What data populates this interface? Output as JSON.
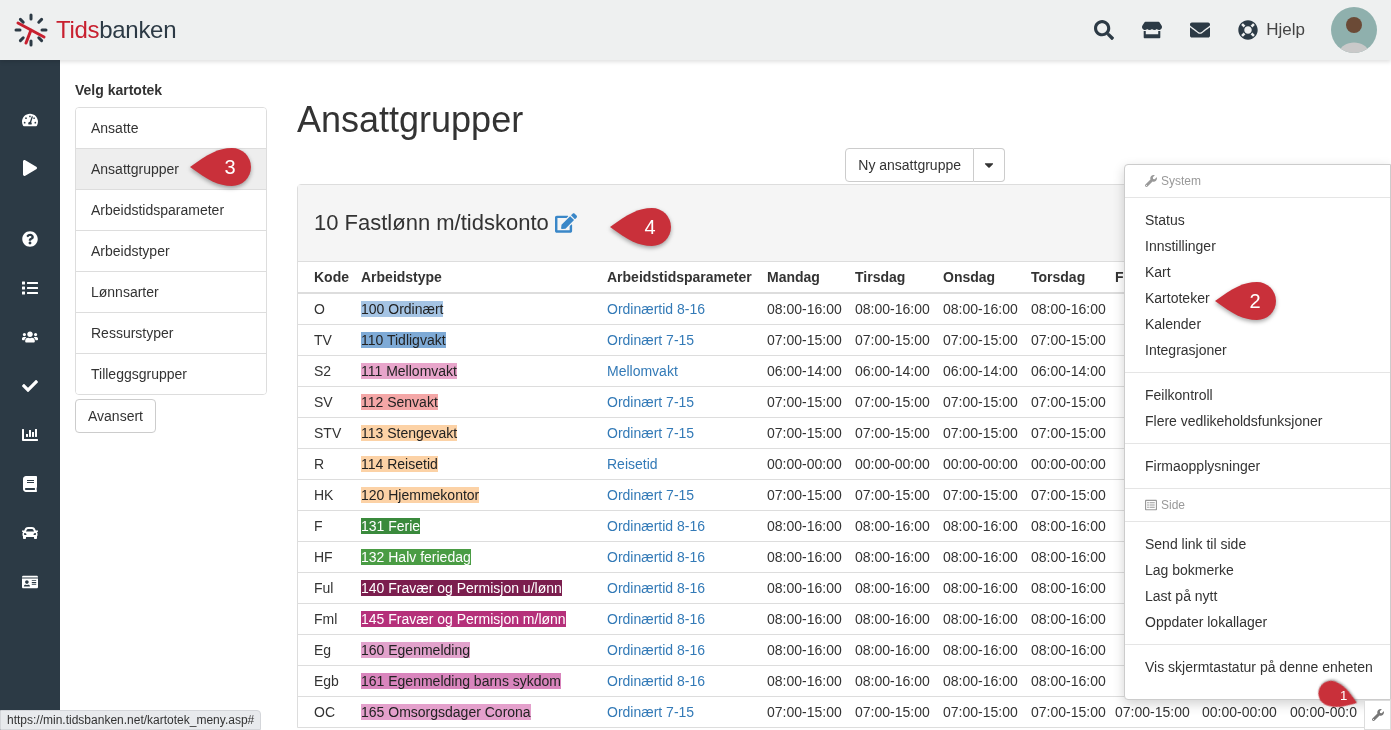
{
  "header": {
    "logo": {
      "accent": "Tids",
      "rest": "banken"
    },
    "help": "Hjelp"
  },
  "kartotek": {
    "title": "Velg kartotek",
    "items": [
      {
        "label": "Ansatte",
        "selected": false
      },
      {
        "label": "Ansattgrupper",
        "selected": true
      },
      {
        "label": "Arbeidstidsparameter",
        "selected": false
      },
      {
        "label": "Arbeidstyper",
        "selected": false
      },
      {
        "label": "Lønnsarter",
        "selected": false
      },
      {
        "label": "Ressurstyper",
        "selected": false
      },
      {
        "label": "Tilleggsgrupper",
        "selected": false
      }
    ],
    "advanced": "Avansert"
  },
  "page_title": "Ansattgrupper",
  "new_button": "Ny ansattgruppe",
  "panel": {
    "title": "10 Fastlønn m/tidskonto"
  },
  "table": {
    "columns": [
      "Kode",
      "Arbeidstype",
      "Arbeidstidsparameter",
      "Mandag",
      "Tirsdag",
      "Onsdag",
      "Torsdag",
      "F"
    ],
    "rows": [
      {
        "code": "O",
        "type": "100 Ordinært",
        "color": "#a5c4e4",
        "param": "Ordinærtid 8-16",
        "days": [
          "08:00-16:00",
          "08:00-16:00",
          "08:00-16:00",
          "08:00-16:00"
        ]
      },
      {
        "code": "TV",
        "type": "110 Tidligvakt",
        "color": "#7eaad6",
        "param": "Ordinært 7-15",
        "days": [
          "07:00-15:00",
          "07:00-15:00",
          "07:00-15:00",
          "07:00-15:00"
        ]
      },
      {
        "code": "S2",
        "type": "111 Mellomvakt",
        "color": "#e8a5cb",
        "param": "Mellomvakt",
        "days": [
          "06:00-14:00",
          "06:00-14:00",
          "06:00-14:00",
          "06:00-14:00"
        ]
      },
      {
        "code": "SV",
        "type": "112 Senvakt",
        "color": "#f4a7a7",
        "param": "Ordinært 7-15",
        "days": [
          "07:00-15:00",
          "07:00-15:00",
          "07:00-15:00",
          "07:00-15:00"
        ]
      },
      {
        "code": "STV",
        "type": "113 Stengevakt",
        "color": "#fcd2a6",
        "param": "Ordinært 7-15",
        "days": [
          "07:00-15:00",
          "07:00-15:00",
          "07:00-15:00",
          "07:00-15:00"
        ]
      },
      {
        "code": "R",
        "type": "114 Reisetid",
        "color": "#fcd2a6",
        "param": "Reisetid",
        "days": [
          "00:00-00:00",
          "00:00-00:00",
          "00:00-00:00",
          "00:00-00:00"
        ]
      },
      {
        "code": "HK",
        "type": "120 Hjemmekontor",
        "color": "#fcd2a6",
        "param": "Ordinært 7-15",
        "days": [
          "07:00-15:00",
          "07:00-15:00",
          "07:00-15:00",
          "07:00-15:00"
        ]
      },
      {
        "code": "F",
        "type": "131 Ferie",
        "color": "#3a8a3c",
        "param": "Ordinærtid 8-16",
        "days": [
          "08:00-16:00",
          "08:00-16:00",
          "08:00-16:00",
          "08:00-16:00"
        ]
      },
      {
        "code": "HF",
        "type": "132 Halv feriedag",
        "color": "#4a9c44",
        "param": "Ordinærtid 8-16",
        "days": [
          "08:00-16:00",
          "08:00-16:00",
          "08:00-16:00",
          "08:00-16:00"
        ]
      },
      {
        "code": "Ful",
        "type": "140 Fravær og Permisjon u/lønn",
        "color": "#7b1e4e",
        "param": "Ordinærtid 8-16",
        "days": [
          "08:00-16:00",
          "08:00-16:00",
          "08:00-16:00",
          "08:00-16:00"
        ]
      },
      {
        "code": "Fml",
        "type": "145 Fravær og Permisjon m/lønn",
        "color": "#b5307a",
        "param": "Ordinærtid 8-16",
        "days": [
          "08:00-16:00",
          "08:00-16:00",
          "08:00-16:00",
          "08:00-16:00"
        ]
      },
      {
        "code": "Eg",
        "type": "160 Egenmelding",
        "color": "#e2a2cc",
        "param": "Ordinærtid 8-16",
        "days": [
          "08:00-16:00",
          "08:00-16:00",
          "08:00-16:00",
          "08:00-16:00"
        ]
      },
      {
        "code": "Egb",
        "type": "161 Egenmelding barns sykdom",
        "color": "#d985bd",
        "param": "Ordinærtid 8-16",
        "days": [
          "08:00-16:00",
          "08:00-16:00",
          "08:00-16:00",
          "08:00-16:00"
        ]
      },
      {
        "code": "OC",
        "type": "165 Omsorgsdager Corona",
        "color": "#e4a0cc",
        "param": "Ordinært 7-15",
        "days": [
          "07:00-15:00",
          "07:00-15:00",
          "07:00-15:00",
          "07:00-15:00",
          "07:00-15:00",
          "00:00-00:00",
          "00:00-00:0"
        ]
      }
    ]
  },
  "menu": {
    "sections": [
      {
        "header": "System",
        "kind": "wrench"
      },
      {
        "items": [
          "Status",
          "Innstillinger",
          "Kart",
          "Kartoteker",
          "Kalender",
          "Integrasjoner"
        ]
      },
      {
        "items": [
          "Feilkontroll",
          "Flere vedlikeholdsfunksjoner"
        ]
      },
      {
        "items": [
          "Firmaopplysninger"
        ]
      },
      {
        "header": "Side",
        "kind": "list"
      },
      {
        "items": [
          "Send link til side",
          "Lag bokmerke",
          "Last på nytt",
          "Oppdater lokallager"
        ]
      },
      {
        "items": [
          "Vis skjermtastatur på denne enheten"
        ]
      }
    ]
  },
  "annotations": [
    "1",
    "2",
    "3",
    "4"
  ],
  "status_url": "https://min.tidsbanken.net/kartotek_meny.asp#"
}
